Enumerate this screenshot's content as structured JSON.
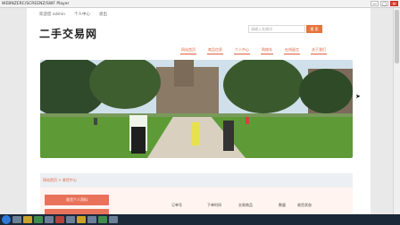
{
  "player": {
    "title": "WEBNZERC/SCREENZ/SWF Player",
    "controls": [
      "—",
      "□",
      "✕"
    ]
  },
  "site": {
    "topbar": [
      "欢迎您 admin",
      "个人中心",
      "退出"
    ],
    "logo": "二手交易网",
    "search": {
      "placeholder": "请输入关键词",
      "button": "搜 索"
    },
    "nav": [
      "网站首页",
      "商品信息",
      "个人中心",
      "购物车",
      "在线留言",
      "关于我们"
    ],
    "breadcrumb": "网站首页 > 收货中心",
    "sidebar": {
      "button": "收货个人资料"
    },
    "table_headers": [
      "订单号",
      "下单时间",
      "交易商品",
      "数量",
      "收货状态"
    ]
  },
  "taskbar": {
    "clock": ""
  }
}
